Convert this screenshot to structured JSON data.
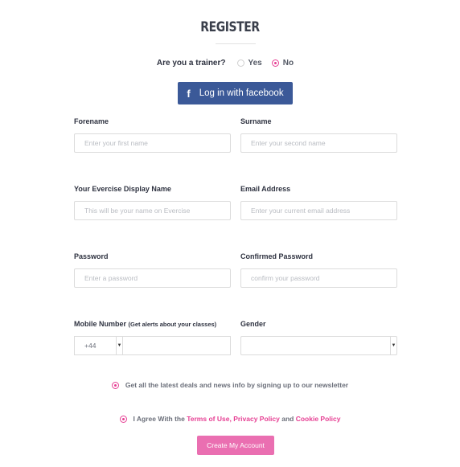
{
  "title": "REGISTER",
  "trainer": {
    "question": "Are you a trainer?",
    "options": [
      {
        "label": "Yes",
        "selected": false
      },
      {
        "label": "No",
        "selected": true
      }
    ]
  },
  "facebook": {
    "label": "Log in with facebook",
    "icon": "facebook-icon"
  },
  "fields": {
    "forename": {
      "label": "Forename",
      "placeholder": "Enter your first name"
    },
    "surname": {
      "label": "Surname",
      "placeholder": "Enter your second name"
    },
    "display_name": {
      "label": "Your Evercise Display Name",
      "placeholder": "This will be your name on Evercise"
    },
    "email": {
      "label": "Email Address",
      "placeholder": "Enter your current email address"
    },
    "password": {
      "label": "Password",
      "placeholder": "Enter a password"
    },
    "confirm_password": {
      "label": "Confirmed Password",
      "placeholder": "confirm your password"
    },
    "mobile": {
      "label": "Mobile Number",
      "note": "(Get alerts about your classes)",
      "prefix": "+44",
      "value": ""
    },
    "gender": {
      "label": "Gender",
      "value": ""
    }
  },
  "newsletter": {
    "text": "Get all the latest deals and news info by signing up to our newsletter",
    "checked": true
  },
  "agree": {
    "prefix": "I Agree With the",
    "terms": "Terms of Use",
    "comma": ",",
    "privacy": "Privacy Policy",
    "and": "and",
    "cookie": "Cookie Policy",
    "checked": true
  },
  "submit_label": "Create My Account",
  "colors": {
    "accent": "#e63f93",
    "facebook": "#3b5998",
    "button": "#ea6fb1"
  }
}
